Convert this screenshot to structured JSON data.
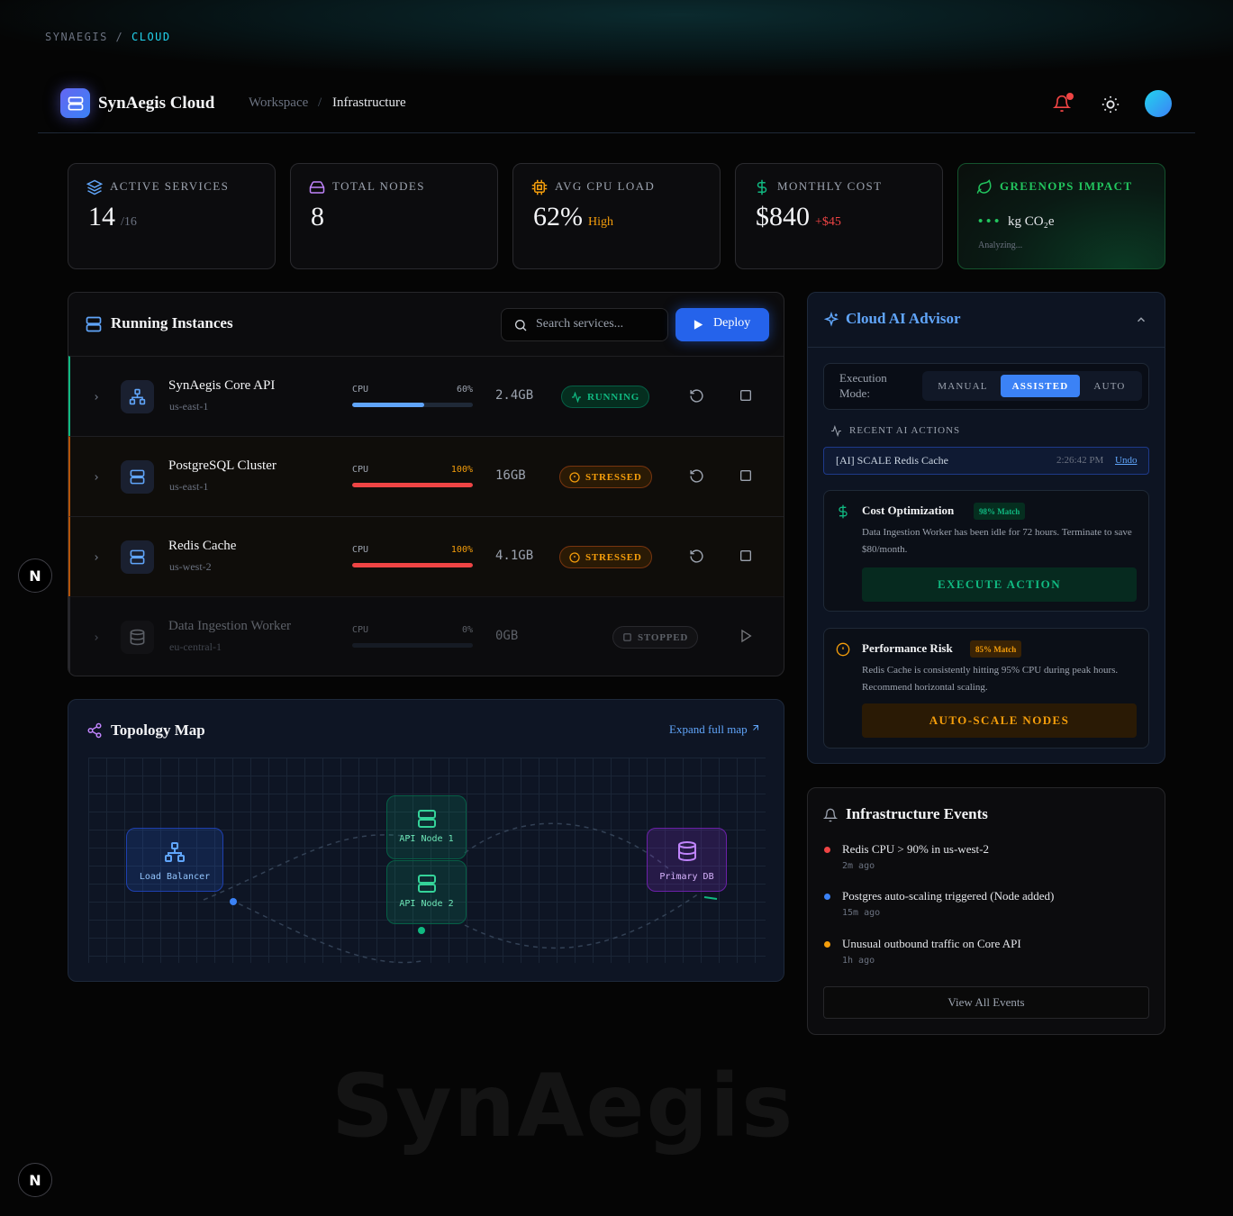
{
  "top_breadcrumb": {
    "root": "SYNAEGIS",
    "sep": "/",
    "current": "CLOUD"
  },
  "header": {
    "brand": "SynAegis Cloud",
    "crumb_workspace": "Workspace",
    "crumb_sep": "/",
    "crumb_current": "Infrastructure"
  },
  "stats": [
    {
      "label": "ACTIVE SERVICES",
      "value": "14",
      "sub": "/16",
      "icon": "layers-icon"
    },
    {
      "label": "TOTAL NODES",
      "value": "8",
      "sub": "",
      "icon": "hard-drive-icon"
    },
    {
      "label": "AVG CPU LOAD",
      "value": "62%",
      "sub": "High",
      "icon": "cpu-icon"
    },
    {
      "label": "MONTHLY COST",
      "value": "$840",
      "sub": "+$45",
      "icon": "dollar-icon"
    },
    {
      "label": "GREENOPS IMPACT",
      "value": "• • •",
      "sub": "kg CO₂e",
      "note": "Analyzing...",
      "icon": "leaf-icon"
    }
  ],
  "instances": {
    "title": "Running Instances",
    "search_placeholder": "Search services...",
    "deploy_label": "Deploy",
    "rows": [
      {
        "name": "SynAegis Core API",
        "region": "us-east-1",
        "cpu_label": "CPU",
        "cpu": "60%",
        "cpu_fraction": 0.6,
        "mem": "2.4GB",
        "status": "RUNNING"
      },
      {
        "name": "PostgreSQL Cluster",
        "region": "us-east-1",
        "cpu_label": "CPU",
        "cpu": "100%",
        "cpu_fraction": 1.0,
        "mem": "16GB",
        "status": "STRESSED"
      },
      {
        "name": "Redis Cache",
        "region": "us-west-2",
        "cpu_label": "CPU",
        "cpu": "100%",
        "cpu_fraction": 1.0,
        "mem": "4.1GB",
        "status": "STRESSED"
      },
      {
        "name": "Data Ingestion Worker",
        "region": "eu-central-1",
        "cpu_label": "CPU",
        "cpu": "0%",
        "cpu_fraction": 0.0,
        "mem": "0GB",
        "status": "STOPPED"
      }
    ]
  },
  "topology": {
    "title": "Topology Map",
    "expand_label": "Expand full map",
    "nodes": [
      {
        "label": "Load Balancer"
      },
      {
        "label": "API Node 1"
      },
      {
        "label": "API Node 2"
      },
      {
        "label": "Primary DB"
      }
    ]
  },
  "advisor": {
    "title": "Cloud AI Advisor",
    "mode_label": "Execution Mode:",
    "modes": [
      "MANUAL",
      "ASSISTED",
      "AUTO"
    ],
    "active_mode": "ASSISTED",
    "recent_heading": "RECENT AI ACTIONS",
    "recent": {
      "action": "[AI] SCALE Redis Cache",
      "time": "2:26:42 PM",
      "undo": "Undo"
    },
    "cards": [
      {
        "title": "Cost Optimization",
        "match": "98% Match",
        "desc": "Data Ingestion Worker has been idle for 72 hours. Terminate to save $80/month.",
        "button": "EXECUTE ACTION"
      },
      {
        "title": "Performance Risk",
        "match": "85% Match",
        "desc": "Redis Cache is consistently hitting 95% CPU during peak hours. Recommend horizontal scaling.",
        "button": "AUTO-SCALE NODES"
      }
    ]
  },
  "events": {
    "title": "Infrastructure Events",
    "items": [
      {
        "text": "Redis CPU > 90% in us-west-2",
        "ago": "2m ago",
        "color": "#ef4444"
      },
      {
        "text": "Postgres auto-scaling triggered (Node added)",
        "ago": "15m ago",
        "color": "#3b82f6"
      },
      {
        "text": "Unusual outbound traffic on Core API",
        "ago": "1h ago",
        "color": "#f59e0b"
      }
    ],
    "view_all": "View All Events"
  },
  "badge_letter": "N",
  "watermark": "SynAegis",
  "colors": {
    "accent": "#2563eb",
    "running": "#10b981",
    "stressed": "#f59e0b",
    "danger": "#ef4444",
    "green": "#22c55e"
  }
}
